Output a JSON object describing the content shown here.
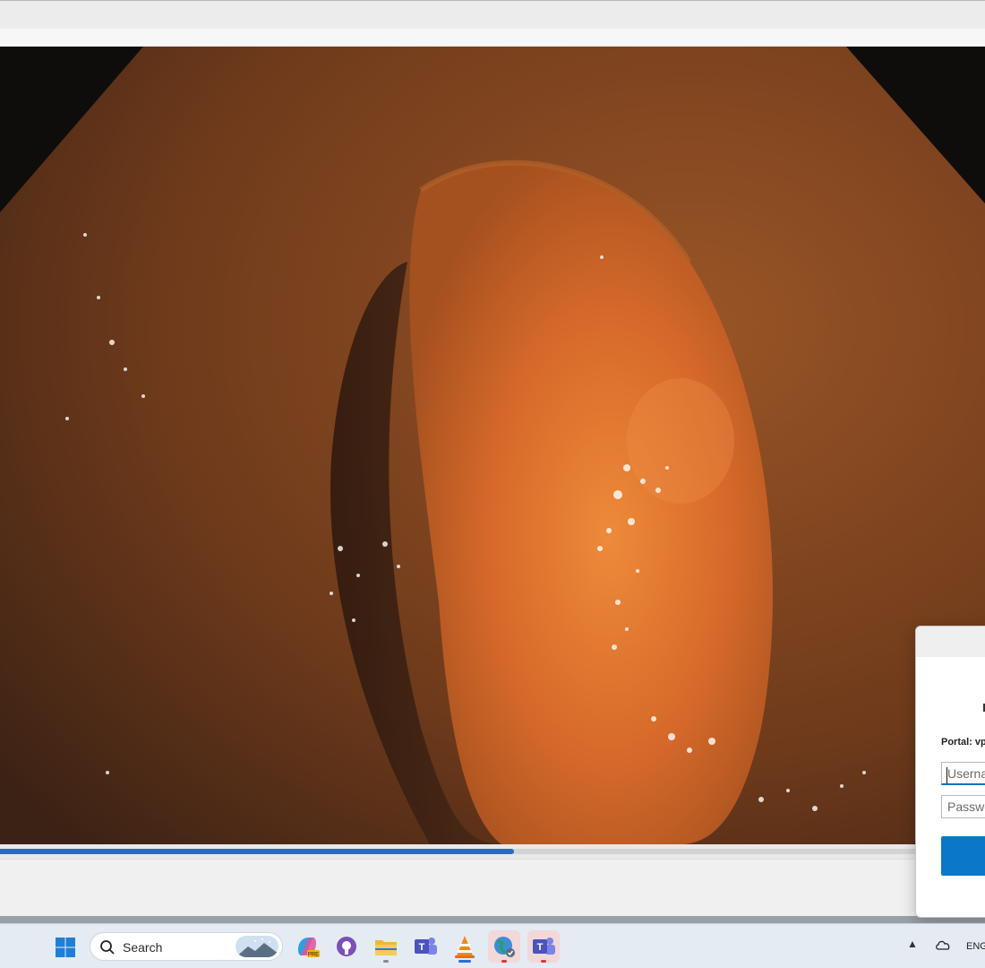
{
  "player": {
    "playback_progress_percent": 52.2
  },
  "login_dialog": {
    "portal_label": "Portal: vp",
    "username_placeholder": "Userna",
    "password_placeholder": "Passwo"
  },
  "taskbar": {
    "search_label": "Search",
    "apps": [
      {
        "name": "copilot-icon",
        "indicator": "none"
      },
      {
        "name": "github-desktop-icon",
        "indicator": "none"
      },
      {
        "name": "file-explorer-icon",
        "indicator": "grey"
      },
      {
        "name": "teams-icon",
        "indicator": "none"
      },
      {
        "name": "vlc-icon",
        "indicator": "blue"
      },
      {
        "name": "vpn-globe-icon",
        "indicator": "red"
      },
      {
        "name": "teams-icon",
        "indicator": "red"
      }
    ],
    "language": "ENG"
  },
  "colors": {
    "accent_blue": "#0a78c7",
    "seek_fill": "#1f6fc9",
    "tissue_orange": "#e8782e"
  }
}
